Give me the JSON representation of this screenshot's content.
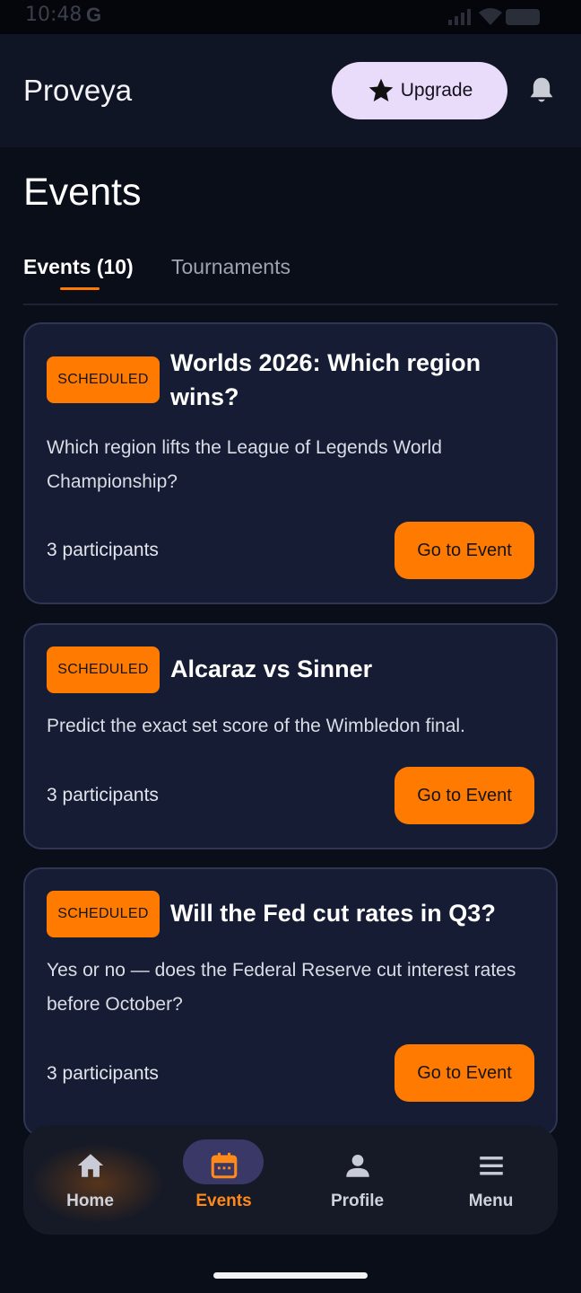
{
  "status_bar": {
    "time": "10:48",
    "notification": "G"
  },
  "app_bar": {
    "title": "Proveya",
    "upgrade_label": "Upgrade"
  },
  "page": {
    "title": "Events"
  },
  "tabs": [
    {
      "label": "Events (10)",
      "active": true
    },
    {
      "label": "Tournaments",
      "active": false
    }
  ],
  "events": [
    {
      "status": "SCHEDULED",
      "title": "Worlds 2026: Which region wins?",
      "description": "Which region lifts the League of Legends World Championship?",
      "participants": "3 participants",
      "button": "Go to Event"
    },
    {
      "status": "SCHEDULED",
      "title": "Alcaraz vs Sinner",
      "description": "Predict the exact set score of the Wimbledon final.",
      "participants": "3 participants",
      "button": "Go to Event"
    },
    {
      "status": "SCHEDULED",
      "title": "Will the Fed cut rates in Q3?",
      "description": "Yes or no — does the Federal Reserve cut interest rates before October?",
      "participants": "3 participants",
      "button": "Go to Event"
    }
  ],
  "bottom_nav": [
    {
      "label": "Home",
      "icon": "home-icon",
      "active": false
    },
    {
      "label": "Events",
      "icon": "calendar-icon",
      "active": true
    },
    {
      "label": "Profile",
      "icon": "person-icon",
      "active": false
    },
    {
      "label": "Menu",
      "icon": "menu-icon",
      "active": false
    }
  ],
  "colors": {
    "accent": "#ff7a00",
    "background": "#0a0e19",
    "card": "#151c33",
    "upgrade_bg": "#e9dcfb"
  }
}
